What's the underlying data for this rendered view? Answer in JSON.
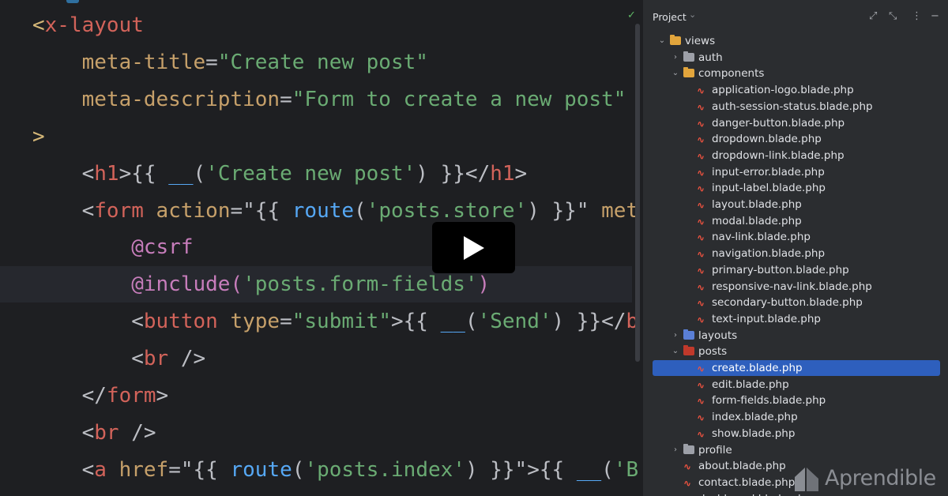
{
  "editor": {
    "lines": [
      [
        [
          "t-tag",
          "<"
        ],
        [
          "t-red",
          "x-layout"
        ]
      ],
      [
        [
          "t-attr",
          "    meta-title"
        ],
        [
          "t-plain",
          "="
        ],
        [
          "t-str",
          "\"Create new post\""
        ]
      ],
      [
        [
          "t-attr",
          "    meta-description"
        ],
        [
          "t-plain",
          "="
        ],
        [
          "t-str",
          "\"Form to create a new post\""
        ]
      ],
      [
        [
          "t-tag",
          ">"
        ]
      ],
      [
        [
          "t-plain",
          "    <"
        ],
        [
          "t-red",
          "h1"
        ],
        [
          "t-plain",
          ">{{ "
        ],
        [
          "t-fn",
          "__"
        ],
        [
          "t-plain",
          "("
        ],
        [
          "t-str",
          "'Create new post'"
        ],
        [
          "t-plain",
          ") }}</"
        ],
        [
          "t-red",
          "h1"
        ],
        [
          "t-plain",
          ">"
        ]
      ],
      [
        [
          "t-plain",
          "    <"
        ],
        [
          "t-red",
          "form"
        ],
        [
          "t-attr",
          " action"
        ],
        [
          "t-plain",
          "=\"{{ "
        ],
        [
          "t-fn",
          "route"
        ],
        [
          "t-plain",
          "("
        ],
        [
          "t-str",
          "'posts.store'"
        ],
        [
          "t-plain",
          ") }}\""
        ],
        [
          "t-attr",
          " met"
        ]
      ],
      [
        [
          "t-dir",
          "        @csrf"
        ]
      ],
      [
        [
          "t-dir",
          "        @include("
        ],
        [
          "t-str",
          "'posts.form-fields'"
        ],
        [
          "t-dir",
          ")"
        ]
      ],
      [
        [
          "t-plain",
          "        <"
        ],
        [
          "t-red",
          "button"
        ],
        [
          "t-attr",
          " type"
        ],
        [
          "t-plain",
          "="
        ],
        [
          "t-str",
          "\"submit\""
        ],
        [
          "t-plain",
          ">{{ "
        ],
        [
          "t-fn",
          "__"
        ],
        [
          "t-plain",
          "("
        ],
        [
          "t-str",
          "'Send'"
        ],
        [
          "t-plain",
          ") }}</"
        ],
        [
          "t-red",
          "b"
        ]
      ],
      [
        [
          "t-plain",
          "        <"
        ],
        [
          "t-red",
          "br"
        ],
        [
          "t-plain",
          " />"
        ]
      ],
      [
        [
          "t-plain",
          "    </"
        ],
        [
          "t-red",
          "form"
        ],
        [
          "t-plain",
          ">"
        ]
      ],
      [
        [
          "t-plain",
          "    <"
        ],
        [
          "t-red",
          "br"
        ],
        [
          "t-plain",
          " />"
        ]
      ],
      [
        [
          "t-plain",
          "    <"
        ],
        [
          "t-red",
          "a"
        ],
        [
          "t-attr",
          " href"
        ],
        [
          "t-plain",
          "=\"{{ "
        ],
        [
          "t-fn",
          "route"
        ],
        [
          "t-plain",
          "("
        ],
        [
          "t-str",
          "'posts.index'"
        ],
        [
          "t-plain",
          ") }}\">{{ "
        ],
        [
          "t-fn",
          "__"
        ],
        [
          "t-plain",
          "("
        ],
        [
          "t-str",
          "'B"
        ]
      ]
    ],
    "highlighted_line": 7,
    "check_mark": "✓"
  },
  "project_panel": {
    "title": "Project",
    "tree": [
      {
        "label": "views",
        "type": "folder",
        "depth": 0,
        "expanded": true,
        "color": "#e2a53c"
      },
      {
        "label": "auth",
        "type": "folder",
        "depth": 1,
        "expanded": false,
        "color": "#9da0a8"
      },
      {
        "label": "components",
        "type": "folder",
        "depth": 1,
        "expanded": true,
        "color": "#e2a53c"
      },
      {
        "label": "application-logo.blade.php",
        "type": "blade",
        "depth": 2
      },
      {
        "label": "auth-session-status.blade.php",
        "type": "blade",
        "depth": 2
      },
      {
        "label": "danger-button.blade.php",
        "type": "blade",
        "depth": 2
      },
      {
        "label": "dropdown.blade.php",
        "type": "blade",
        "depth": 2
      },
      {
        "label": "dropdown-link.blade.php",
        "type": "blade",
        "depth": 2
      },
      {
        "label": "input-error.blade.php",
        "type": "blade",
        "depth": 2
      },
      {
        "label": "input-label.blade.php",
        "type": "blade",
        "depth": 2
      },
      {
        "label": "layout.blade.php",
        "type": "blade",
        "depth": 2
      },
      {
        "label": "modal.blade.php",
        "type": "blade",
        "depth": 2
      },
      {
        "label": "nav-link.blade.php",
        "type": "blade",
        "depth": 2
      },
      {
        "label": "navigation.blade.php",
        "type": "blade",
        "depth": 2
      },
      {
        "label": "primary-button.blade.php",
        "type": "blade",
        "depth": 2
      },
      {
        "label": "responsive-nav-link.blade.php",
        "type": "blade",
        "depth": 2
      },
      {
        "label": "secondary-button.blade.php",
        "type": "blade",
        "depth": 2
      },
      {
        "label": "text-input.blade.php",
        "type": "blade",
        "depth": 2
      },
      {
        "label": "layouts",
        "type": "folder",
        "depth": 1,
        "expanded": false,
        "color": "#5a7fd6"
      },
      {
        "label": "posts",
        "type": "folder",
        "depth": 1,
        "expanded": true,
        "color": "#c0392b"
      },
      {
        "label": "create.blade.php",
        "type": "blade",
        "depth": 2,
        "selected": true
      },
      {
        "label": "edit.blade.php",
        "type": "blade",
        "depth": 2
      },
      {
        "label": "form-fields.blade.php",
        "type": "blade",
        "depth": 2
      },
      {
        "label": "index.blade.php",
        "type": "blade",
        "depth": 2
      },
      {
        "label": "show.blade.php",
        "type": "blade",
        "depth": 2
      },
      {
        "label": "profile",
        "type": "folder",
        "depth": 1,
        "expanded": false,
        "color": "#9da0a8"
      },
      {
        "label": "about.blade.php",
        "type": "blade",
        "depth": 1
      },
      {
        "label": "contact.blade.php",
        "type": "blade",
        "depth": 1
      },
      {
        "label": "dashboard.blade.php",
        "type": "blade",
        "depth": 1
      }
    ]
  },
  "watermark": {
    "text": "Aprendible"
  }
}
